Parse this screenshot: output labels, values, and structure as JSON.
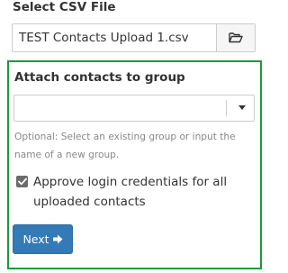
{
  "file_section": {
    "title": "Select CSV File",
    "file_name": "TEST Contacts Upload 1.csv",
    "browse_icon": "folder-open-icon"
  },
  "group_section": {
    "label": "Attach contacts to group",
    "select_value": "",
    "help_text": "Optional: Select an existing group or input the name of a new group.",
    "highlight_color": "#1a9a3a"
  },
  "approve": {
    "checked": true,
    "label": "Approve login credentials for all uploaded contacts"
  },
  "next_button": {
    "label": "Next",
    "icon": "arrow-right-icon",
    "color": "#337ab7"
  }
}
